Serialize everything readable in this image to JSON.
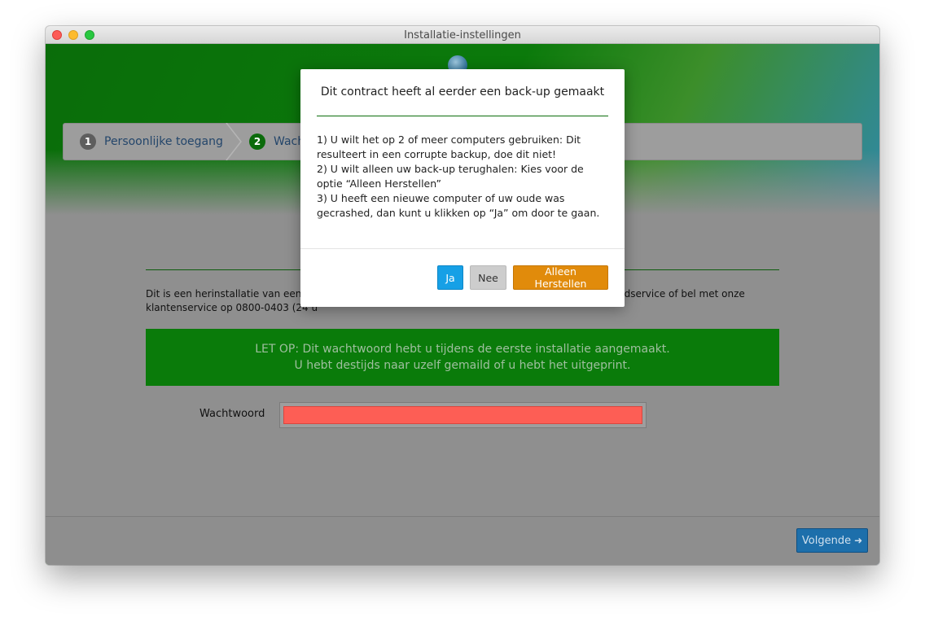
{
  "window": {
    "title": "Installatie-instellingen"
  },
  "steps": [
    {
      "number": "1",
      "label": "Persoonlijke toegang"
    },
    {
      "number": "2",
      "label": "Wach"
    }
  ],
  "page": {
    "info_line1": "Dit is een herinstallatie van een be",
    "info_line1_rest": "udservice of bel met onze",
    "info_line2": "klantenservice op 0800-0403 (24 u",
    "banner_line1": "LET OP: Dit wachtwoord hebt u tijdens de eerste installatie aangemaakt.",
    "banner_line2": "U hebt destijds naar uzelf gemaild of u hebt het uitgeprint.",
    "password_label": "Wachtwoord",
    "password_value": ""
  },
  "footer": {
    "next_label": "Volgende",
    "next_arrow": "➜"
  },
  "modal": {
    "title": "Dit contract heeft al eerder een back-up gemaakt",
    "lines": [
      "1) U wilt het op 2 of meer computers gebruiken: Dit resulteert in een corrupte backup, doe dit niet!",
      "2) U wilt alleen uw back-up terughalen: Kies voor de optie “Alleen Herstellen”",
      "3) U heeft een nieuwe computer of uw oude was gecrashed, dan kunt u klikken op “Ja” om door te gaan."
    ],
    "buttons": {
      "yes": "Ja",
      "no": "Nee",
      "restore": "Alleen Herstellen"
    }
  },
  "colors": {
    "accent_green": "#0a7b0a",
    "yes_button": "#16a0e6",
    "restore_button": "#e18b0b",
    "password_field_error": "#fd5e55",
    "next_button": "#1d6fab"
  }
}
